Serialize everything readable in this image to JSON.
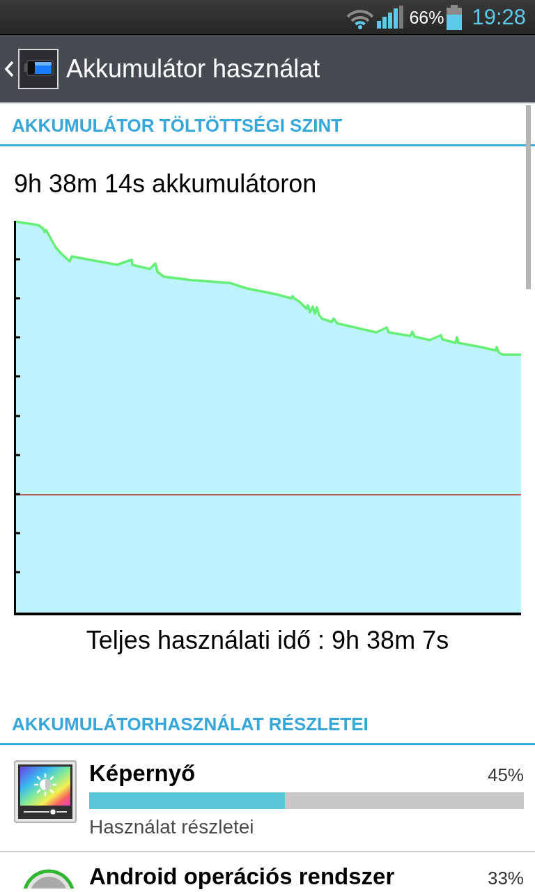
{
  "status_bar": {
    "battery_text": "66%",
    "time": "19:28"
  },
  "action_bar": {
    "title": "Akkumulátor használat"
  },
  "level_section": {
    "header": "AKKUMULÁTOR TÖLTÖTTSÉGI SZINT",
    "on_battery": "9h 38m 14s akkumulátoron",
    "total_usage": "Teljes használati idő : 9h 38m 7s"
  },
  "details_section": {
    "header": "AKKUMULÁTORHASZNÁLAT RÉSZLETEI",
    "items": [
      {
        "kind": "screen",
        "name": "Képernyő",
        "percent": "45%",
        "level": 0.45,
        "subtitle": "Használat részletei"
      },
      {
        "kind": "system",
        "name": "Android operációs rendszer",
        "percent": "33%"
      }
    ]
  }
}
